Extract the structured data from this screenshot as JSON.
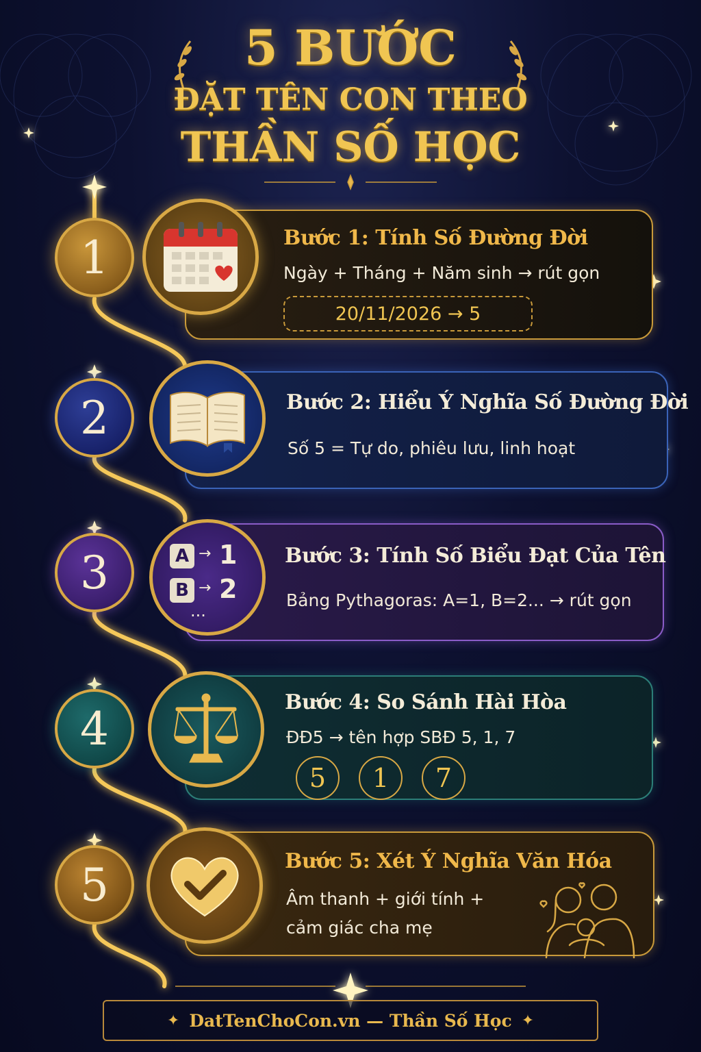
{
  "title": {
    "line1": "5 BƯỚC",
    "line2": "ĐẶT TÊN CON THEO",
    "line3": "THẦN SỐ HỌC"
  },
  "steps": [
    {
      "number": "1",
      "icon": "calendar-heart-icon",
      "title": "Bước 1: Tính Số Đường Đời",
      "desc": "Ngày + Tháng + Năm sinh → rút gọn",
      "formula": "20/11/2026  →  5",
      "accent": "#f0b84a"
    },
    {
      "number": "2",
      "icon": "open-book-icon",
      "title": "Bước 2: Hiểu Ý Nghĩa Số Đường Đời",
      "desc": "Số 5 = Tự do, phiêu lưu, linh hoạt",
      "accent": "#f4ecd8"
    },
    {
      "number": "3",
      "icon": "letter-number-map-icon",
      "title": "Bước 3: Tính Số Biểu Đạt Của Tên",
      "desc": "Bảng Pythagoras: A=1, B=2... → rút gọn",
      "icon_text": {
        "a": "A",
        "a_num": "1",
        "b": "B",
        "b_num": "2",
        "more": "..."
      },
      "accent": "#f4ecd8"
    },
    {
      "number": "4",
      "icon": "balance-scale-icon",
      "title": "Bước 4: So Sánh Hài Hòa",
      "desc": "ĐĐ5 → tên hợp SBĐ 5, 1, 7",
      "compatible": [
        "5",
        "1",
        "7"
      ],
      "accent": "#f4ecd8"
    },
    {
      "number": "5",
      "icon": "heart-check-icon",
      "title": "Bước 5: Xét Ý Nghĩa Văn Hóa",
      "desc_line1": "Âm thanh + giới tính +",
      "desc_line2": "cảm giác cha mẹ",
      "illustration": "family-icon",
      "accent": "#f0b84a"
    }
  ],
  "footer": {
    "text": "DatTenChoCon.vn — Thần Số Học"
  },
  "colors": {
    "gold": "#f0c552",
    "background": "#0d1130"
  }
}
